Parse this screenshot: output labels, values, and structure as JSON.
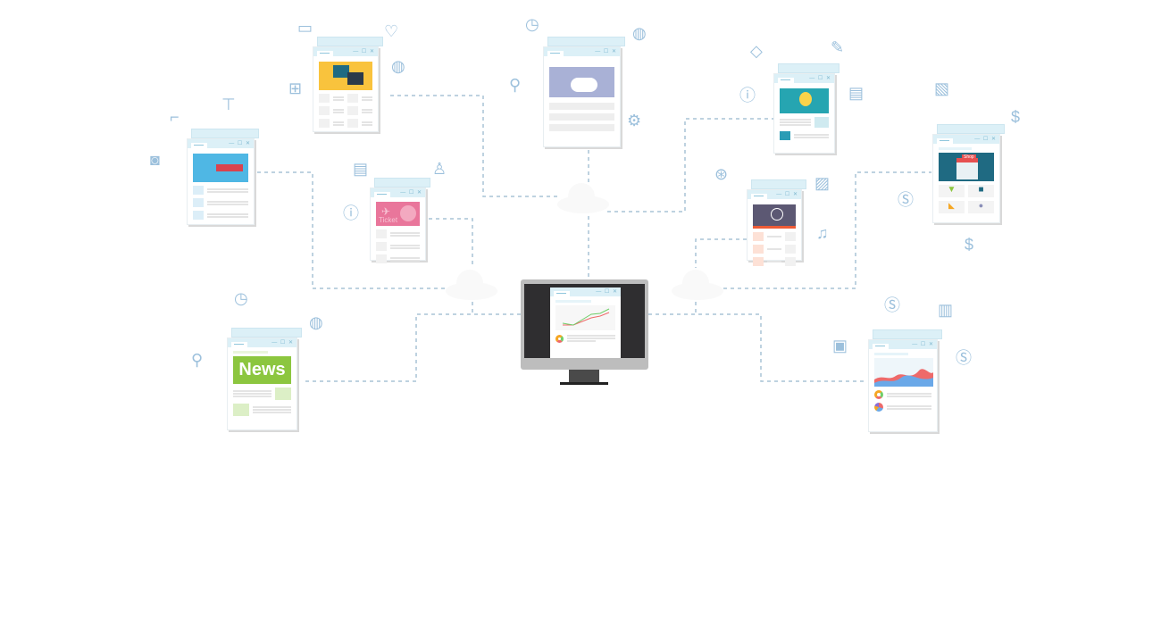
{
  "colors": {
    "connector": "#a9c4d6",
    "titlebar": "#dcf0f7",
    "icon": "#9cc0dc",
    "monitor_frame": "#bdbdbd",
    "monitor_screen": "#2f2e30"
  },
  "window_controls": "— ☐ ✕",
  "windows": [
    {
      "theme": "chat",
      "banner_color": "#f9c33d"
    },
    {
      "theme": "payment",
      "banner_color": "#4fb7e4"
    },
    {
      "theme": "travel",
      "banner_color": "#e9769b",
      "banner_text": "Ticket"
    },
    {
      "theme": "cloud",
      "banner_color": "#a9b1d6"
    },
    {
      "theme": "idea",
      "banner_color": "#26a5b1"
    },
    {
      "theme": "video",
      "banner_color": "#5c5873"
    },
    {
      "theme": "shop",
      "banner_color": "#1f6a82",
      "sign_text": "Shop"
    },
    {
      "theme": "news",
      "banner_color": "#8cc63f",
      "banner_text": "News"
    },
    {
      "theme": "analytics",
      "banner_color": "#e9f3f8"
    }
  ],
  "icons": [
    "chat-bubble",
    "heart",
    "globe",
    "gift",
    "shirt",
    "heel",
    "camera",
    "magnifier",
    "stopwatch",
    "gear",
    "graduation-cap",
    "pencil",
    "info",
    "newspaper",
    "banknote",
    "dollar",
    "film-camera",
    "clapper",
    "music-note",
    "bar-chart",
    "ticket-card",
    "stamp"
  ]
}
